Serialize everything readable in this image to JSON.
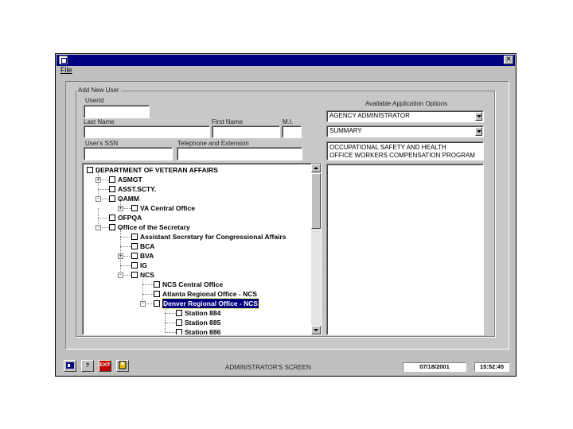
{
  "window": {
    "menu": {
      "file_label": "File"
    },
    "close_glyph": "✕"
  },
  "form": {
    "group_label": "Add New User",
    "user_id_label": "UserId",
    "user_id_value": "",
    "last_name_label": "Last Name",
    "last_name_value": "",
    "first_name_label": "First Name",
    "first_name_value": "",
    "mi_label": "M.I.",
    "mi_value": "",
    "ssn_label": "User's SSN",
    "ssn_value": "",
    "phone_label": "Telephone and Extension",
    "phone_value": "",
    "available_label": "Available Application Options",
    "option1_selected": "AGENCY ADMINISTRATOR",
    "option2_selected": "SUMMARY",
    "program_text_1": "OCCUPATIONAL SAFETY AND HEALTH",
    "program_text_2": "OFFICE WORKERS COMPENSATION PROGRAM"
  },
  "tree": {
    "nodes": [
      {
        "label": "DEPARTMENT OF VETERAN AFFAIRS",
        "level": 0,
        "expander": "none"
      },
      {
        "label": "ASMGT",
        "level": 1,
        "expander": "+"
      },
      {
        "label": "ASST.SCTY.",
        "level": 1,
        "expander": "none"
      },
      {
        "label": "OAMM",
        "level": 1,
        "expander": "-"
      },
      {
        "label": "VA Central Office",
        "level": 2,
        "expander": "+"
      },
      {
        "label": "OFPQA",
        "level": 1,
        "expander": "none"
      },
      {
        "label": "Office of the Secretary",
        "level": 1,
        "expander": "-"
      },
      {
        "label": "Assistant Secretary for Congressional Affairs",
        "level": 2,
        "expander": "none"
      },
      {
        "label": "BCA",
        "level": 2,
        "expander": "none"
      },
      {
        "label": "BVA",
        "level": 2,
        "expander": "+"
      },
      {
        "label": "IG",
        "level": 2,
        "expander": "none"
      },
      {
        "label": "NCS",
        "level": 2,
        "expander": "-"
      },
      {
        "label": "NCS Central Office",
        "level": 3,
        "expander": "none"
      },
      {
        "label": "Atlanta Regional Office - NCS",
        "level": 3,
        "expander": "none"
      },
      {
        "label": "Denver Regional Office - NCS",
        "level": 3,
        "expander": "-",
        "selected": true
      },
      {
        "label": "Station 884",
        "level": 4,
        "expander": "none"
      },
      {
        "label": "Station 885",
        "level": 4,
        "expander": "none"
      },
      {
        "label": "Station 886",
        "level": 4,
        "expander": "none"
      }
    ]
  },
  "status": {
    "screen_name": "ADMINISTRATOR'S SCREEN",
    "date": "07/18/2001",
    "time": "15:52:45",
    "toolbar": [
      {
        "name": "users-icon"
      },
      {
        "name": "help-icon",
        "glyph": "?"
      },
      {
        "name": "exit-icon",
        "glyph": "EXIT"
      },
      {
        "name": "save-icon"
      }
    ]
  }
}
